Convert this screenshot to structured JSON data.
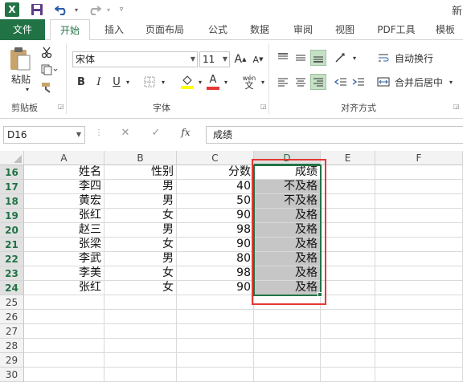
{
  "app": {
    "logo_letter": "X",
    "title_fragment": "新"
  },
  "quick_access": {
    "save_icon": "save-icon",
    "undo_icon": "undo-icon",
    "redo_icon": "redo-icon",
    "customize_icon": "chevron-down-icon"
  },
  "tabs": [
    {
      "label": "文件"
    },
    {
      "label": "开始"
    },
    {
      "label": "插入"
    },
    {
      "label": "页面布局"
    },
    {
      "label": "公式"
    },
    {
      "label": "数据"
    },
    {
      "label": "审阅"
    },
    {
      "label": "视图"
    },
    {
      "label": "PDF工具"
    },
    {
      "label": "模板"
    }
  ],
  "ribbon": {
    "clipboard": {
      "paste_label": "粘贴",
      "group_label": "剪贴板"
    },
    "font": {
      "font_name": "宋体",
      "font_size": "11",
      "bold": "B",
      "italic": "I",
      "underline": "U",
      "grow": "A",
      "shrink": "A",
      "font_color_letter": "A",
      "phonetic": "wén",
      "group_label": "字体",
      "highlight_color": "#ffff00",
      "font_color": "#e53935"
    },
    "alignment": {
      "wrap_text": "自动换行",
      "merge_center": "合并后居中",
      "group_label": "对齐方式"
    }
  },
  "formula_bar": {
    "name_box": "D16",
    "cancel_icon": "✕",
    "enter_icon": "✓",
    "fx": "fx",
    "content": "成绩"
  },
  "sheet": {
    "columns": [
      "A",
      "B",
      "C",
      "D",
      "E",
      "F"
    ],
    "rows": [
      "16",
      "17",
      "18",
      "19",
      "20",
      "21",
      "22",
      "23",
      "24",
      "25",
      "26",
      "27",
      "28",
      "29",
      "30"
    ],
    "data": [
      [
        "姓名",
        "性别",
        "分数",
        "成绩"
      ],
      [
        "李四",
        "男",
        "40",
        "不及格"
      ],
      [
        "黄宏",
        "男",
        "50",
        "不及格"
      ],
      [
        "张红",
        "女",
        "90",
        "及格"
      ],
      [
        "赵三",
        "男",
        "98",
        "及格"
      ],
      [
        "张梁",
        "女",
        "90",
        "及格"
      ],
      [
        "李武",
        "男",
        "80",
        "及格"
      ],
      [
        "李美",
        "女",
        "98",
        "及格"
      ],
      [
        "张红",
        "女",
        "90",
        "及格"
      ]
    ],
    "active_cell": "D16",
    "selection": "D16:D24"
  }
}
